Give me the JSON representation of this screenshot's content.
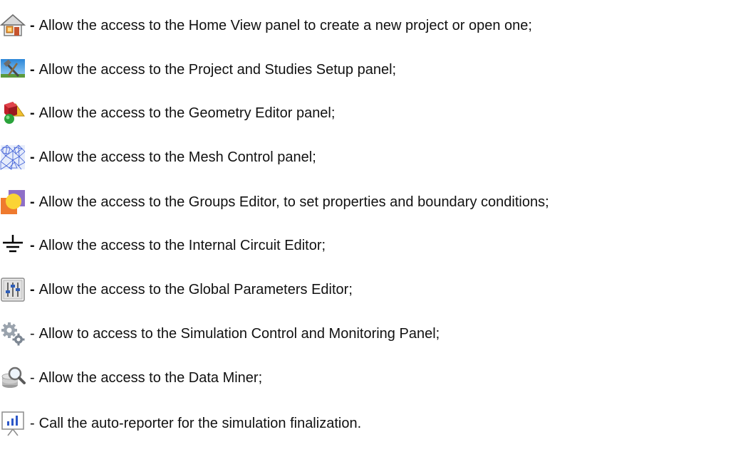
{
  "items": [
    {
      "icon": "home-view-icon",
      "dash": "-",
      "text": "Allow the access to the Home View panel to create a new project or open one;"
    },
    {
      "icon": "project-setup-icon",
      "dash": "-",
      "text": "Allow the access to the Project and Studies Setup panel;"
    },
    {
      "icon": "geometry-editor-icon",
      "dash": "-",
      "text": "Allow the access to the Geometry Editor panel;"
    },
    {
      "icon": "mesh-control-icon",
      "dash": "-",
      "text": "Allow the access to the Mesh Control panel;"
    },
    {
      "icon": "groups-editor-icon",
      "dash": "-",
      "text": "Allow the access to the Groups Editor, to set properties and boundary conditions;"
    },
    {
      "icon": "ground-circuit-icon",
      "dash": "-",
      "text": "Allow the access to the Internal Circuit Editor;"
    },
    {
      "icon": "global-parameters-icon",
      "dash": "-",
      "text": "Allow the access to the Global Parameters Editor;"
    },
    {
      "icon": "simulation-gear-icon",
      "dash": "-",
      "text": "Allow to access to the Simulation Control and Monitoring Panel;"
    },
    {
      "icon": "data-miner-icon",
      "dash": "-",
      "text": "Allow the access to the Data Miner;"
    },
    {
      "icon": "auto-reporter-icon",
      "dash": "-",
      "text": "Call the auto-reporter for the simulation finalization."
    }
  ]
}
